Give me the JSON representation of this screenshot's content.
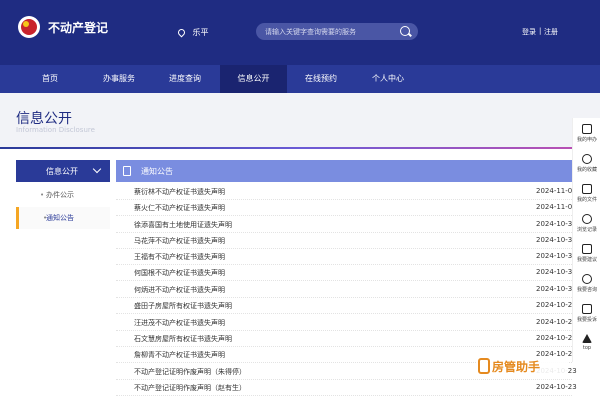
{
  "header": {
    "site_title": "不动产登记",
    "location": "乐平",
    "search_placeholder": "请输入关键字查询需要的服务",
    "login": "登录",
    "separator": "|",
    "register": "注册"
  },
  "nav": {
    "items": [
      "首页",
      "办事服务",
      "进度查询",
      "信息公开",
      "在线预约",
      "个人中心"
    ],
    "active": "信息公开"
  },
  "banner": {
    "title": "信息公开",
    "subtitle": "Information Disclosure"
  },
  "sidebar": {
    "heading": "信息公开",
    "items": [
      "办件公示",
      "通知公告"
    ],
    "active": "通知公告"
  },
  "notices": {
    "heading": "通知公告",
    "rows": [
      {
        "title": "蔡衍林不动产权证书遗失声明",
        "date": "2024-11-0"
      },
      {
        "title": "蔡火仁不动产权证书遗失声明",
        "date": "2024-11-0"
      },
      {
        "title": "徐添喜国有土地使用证遗失声明",
        "date": "2024-10-3"
      },
      {
        "title": "马花萍不动产权证书遗失声明",
        "date": "2024-10-3"
      },
      {
        "title": "王福有不动产权证书遗失声明",
        "date": "2024-10-3"
      },
      {
        "title": "何国根不动产权证书遗失声明",
        "date": "2024-10-3"
      },
      {
        "title": "何炳进不动产权证书遗失声明",
        "date": "2024-10-3"
      },
      {
        "title": "盛田子房屋所有权证书遗失声明",
        "date": "2024-10-2"
      },
      {
        "title": "汪进茂不动产权证书遗失声明",
        "date": "2024-10-2"
      },
      {
        "title": "石文慧房屋所有权证书遗失声明",
        "date": "2024-10-2"
      },
      {
        "title": "詹柳青不动产权证书遗失声明",
        "date": "2024-10-2"
      },
      {
        "title": "不动产登记证明作废声明（朱得停）",
        "date": "2024-10-23"
      },
      {
        "title": "不动产登记证明作废声明（赵有生）",
        "date": "2024-10-23"
      }
    ]
  },
  "rail": {
    "items": [
      {
        "label": "我的申办",
        "icon": "briefcase-icon"
      },
      {
        "label": "我的收藏",
        "icon": "star-icon"
      },
      {
        "label": "我的文件",
        "icon": "folder-icon"
      },
      {
        "label": "浏览记录",
        "icon": "history-icon"
      },
      {
        "label": "我要建议",
        "icon": "suggest-icon"
      },
      {
        "label": "我要咨询",
        "icon": "chat-icon"
      },
      {
        "label": "我要投诉",
        "icon": "complaint-icon"
      },
      {
        "label": "top",
        "icon": "rocket-icon"
      }
    ]
  },
  "watermark": {
    "text": "房管助手"
  },
  "colors": {
    "header_bg": "#1f2c82",
    "nav_bg": "#2a3a98",
    "nav_active": "#1a2470",
    "list_head": "#7a8de0",
    "side_active_bar": "#f5a623",
    "watermark": "#e58a1f"
  }
}
